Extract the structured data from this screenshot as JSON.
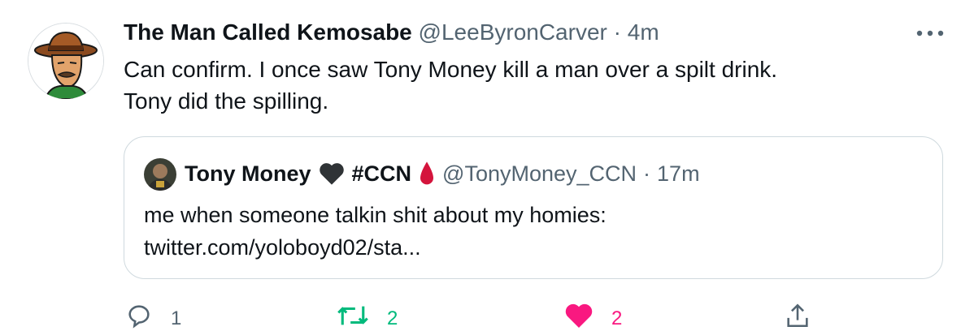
{
  "tweet": {
    "author_name": "The Man Called Kemosabe",
    "author_handle": "@LeeByronCarver",
    "separator": "·",
    "time": "4m",
    "text_lines": [
      "Can confirm. I once saw Tony Money kill a man over a spilt drink.",
      "Tony did the spilling."
    ]
  },
  "quote": {
    "author_name": "Tony Money",
    "hashtag": "#CCN",
    "author_handle": "@TonyMoney_CCN",
    "separator": "·",
    "time": "17m",
    "text_lines": [
      "me when someone talkin shit about my homies:",
      "twitter.com/yoloboyd02/sta..."
    ]
  },
  "actions": {
    "reply_count": "1",
    "retweet_count": "2",
    "like_count": "2"
  },
  "colors": {
    "text": "#0f1419",
    "secondary": "#536471",
    "border": "#cfd9de",
    "retweet": "#00ba7c",
    "like": "#f91880",
    "blood_drop": "#d4143c",
    "heart_dark": "#2f3336"
  },
  "icons": [
    "more-icon",
    "black-heart-icon",
    "drop-of-blood-icon",
    "reply-icon",
    "retweet-icon",
    "like-icon",
    "share-icon"
  ]
}
